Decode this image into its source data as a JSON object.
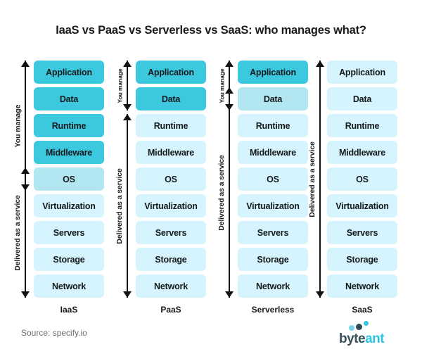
{
  "title": "IaaS vs PaaS vs Serverless vs SaaS: who manages what?",
  "layer_names": [
    "Application",
    "Data",
    "Runtime",
    "Middleware",
    "OS",
    "Virtualization",
    "Servers",
    "Storage",
    "Network"
  ],
  "labels": {
    "you_manage": "You manage",
    "delivered": "Delivered as a service"
  },
  "colors": {
    "dark": "#3cc9df",
    "mid": "#b2e7f1",
    "light": "#d5f4fd",
    "text": "#15191c",
    "arrow": "#111111",
    "source": "#6d6d6d",
    "logo_byte": "#35505c",
    "logo_ant": "#2ec4e0"
  },
  "columns": [
    {
      "name": "IaaS",
      "layers": [
        {
          "label": "Application",
          "shade": "dark"
        },
        {
          "label": "Data",
          "shade": "dark"
        },
        {
          "label": "Runtime",
          "shade": "dark"
        },
        {
          "label": "Middleware",
          "shade": "dark"
        },
        {
          "label": "OS",
          "shade": "mid"
        },
        {
          "label": "Virtualization",
          "shade": "light"
        },
        {
          "label": "Servers",
          "shade": "light"
        },
        {
          "label": "Storage",
          "shade": "light"
        },
        {
          "label": "Network",
          "shade": "light"
        }
      ],
      "arrows": [
        {
          "label": "You manage",
          "from": 0,
          "to": 4
        },
        {
          "label": "Delivered as a service",
          "from": 4,
          "to": 8
        }
      ]
    },
    {
      "name": "PaaS",
      "layers": [
        {
          "label": "Application",
          "shade": "dark"
        },
        {
          "label": "Data",
          "shade": "dark"
        },
        {
          "label": "Runtime",
          "shade": "light"
        },
        {
          "label": "Middleware",
          "shade": "light"
        },
        {
          "label": "OS",
          "shade": "light"
        },
        {
          "label": "Virtualization",
          "shade": "light"
        },
        {
          "label": "Servers",
          "shade": "light"
        },
        {
          "label": "Storage",
          "shade": "light"
        },
        {
          "label": "Network",
          "shade": "light"
        }
      ],
      "arrows": [
        {
          "label": "You manage",
          "from": 0,
          "to": 1
        },
        {
          "label": "Delivered as a service",
          "from": 2,
          "to": 8
        }
      ]
    },
    {
      "name": "Serverless",
      "layers": [
        {
          "label": "Application",
          "shade": "dark"
        },
        {
          "label": "Data",
          "shade": "mid"
        },
        {
          "label": "Runtime",
          "shade": "light"
        },
        {
          "label": "Middleware",
          "shade": "light"
        },
        {
          "label": "OS",
          "shade": "light"
        },
        {
          "label": "Virtualization",
          "shade": "light"
        },
        {
          "label": "Servers",
          "shade": "light"
        },
        {
          "label": "Storage",
          "shade": "light"
        },
        {
          "label": "Network",
          "shade": "light"
        }
      ],
      "arrows": [
        {
          "label": "You manage",
          "from": 0,
          "to": 1
        },
        {
          "label": "Delivered as a service",
          "from": 1,
          "to": 8
        }
      ]
    },
    {
      "name": "SaaS",
      "layers": [
        {
          "label": "Application",
          "shade": "light"
        },
        {
          "label": "Data",
          "shade": "light"
        },
        {
          "label": "Runtime",
          "shade": "light"
        },
        {
          "label": "Middleware",
          "shade": "light"
        },
        {
          "label": "OS",
          "shade": "light"
        },
        {
          "label": "Virtualization",
          "shade": "light"
        },
        {
          "label": "Servers",
          "shade": "light"
        },
        {
          "label": "Storage",
          "shade": "light"
        },
        {
          "label": "Network",
          "shade": "light"
        }
      ],
      "arrows": [
        {
          "label": "Delivered as a service",
          "from": 0,
          "to": 8
        }
      ]
    }
  ],
  "footer": {
    "source": "Source: specify.io",
    "logo": {
      "word_first": "byte",
      "word_second": "ant",
      "dots": [
        "dot-left",
        "dot-middle",
        "dot-right"
      ]
    }
  }
}
